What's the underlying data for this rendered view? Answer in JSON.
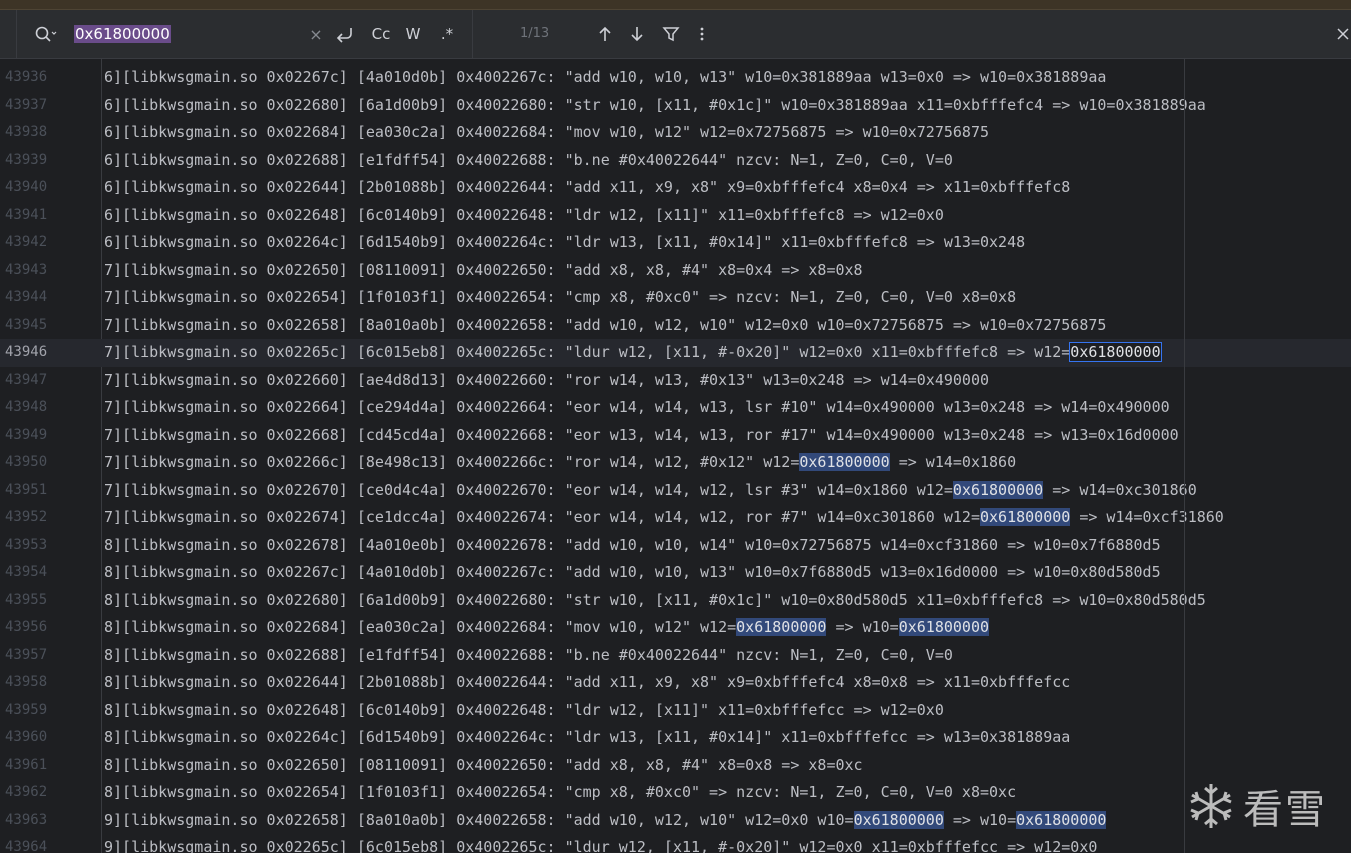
{
  "search": {
    "query": "0x61800000",
    "counter": "1/13",
    "icons": [
      "search-icon",
      "clear-icon",
      "newline-icon",
      "match-case-icon",
      "whole-word-icon",
      "regex-icon",
      "prev-match-icon",
      "next-match-icon",
      "filter-icon",
      "more-icon",
      "close-icon"
    ],
    "labels": {
      "match_case": "Cc",
      "whole_word": "W",
      "regex": ".*"
    }
  },
  "editor": {
    "current_line": "43946",
    "lines": [
      {
        "n": "43936",
        "segs": [
          {
            "t": "6][libkwsgmain.so 0x02267c] [4a010d0b] 0x4002267c: \"add w10, w10, w13\" w10=0x381889aa w13=0x0 => w10=0x381889aa"
          }
        ]
      },
      {
        "n": "43937",
        "segs": [
          {
            "t": "6][libkwsgmain.so 0x022680] [6a1d00b9] 0x40022680: \"str w10, [x11, #0x1c]\" w10=0x381889aa x11=0xbfffefc4 => w10=0x381889aa"
          }
        ]
      },
      {
        "n": "43938",
        "segs": [
          {
            "t": "6][libkwsgmain.so 0x022684] [ea030c2a] 0x40022684: \"mov w10, w12\" w12=0x72756875 => w10=0x72756875"
          }
        ]
      },
      {
        "n": "43939",
        "segs": [
          {
            "t": "6][libkwsgmain.so 0x022688] [e1fdff54] 0x40022688: \"b.ne #0x40022644\" nzcv: N=1, Z=0, C=0, V=0"
          }
        ]
      },
      {
        "n": "43940",
        "segs": [
          {
            "t": "6][libkwsgmain.so 0x022644] [2b01088b] 0x40022644: \"add x11, x9, x8\" x9=0xbfffefc4 x8=0x4 => x11=0xbfffefc8"
          }
        ]
      },
      {
        "n": "43941",
        "segs": [
          {
            "t": "6][libkwsgmain.so 0x022648] [6c0140b9] 0x40022648: \"ldr w12, [x11]\" x11=0xbfffefc8 => w12=0x0"
          }
        ]
      },
      {
        "n": "43942",
        "segs": [
          {
            "t": "6][libkwsgmain.so 0x02264c] [6d1540b9] 0x4002264c: \"ldr w13, [x11, #0x14]\" x11=0xbfffefc8 => w13=0x248"
          }
        ]
      },
      {
        "n": "43943",
        "segs": [
          {
            "t": "7][libkwsgmain.so 0x022650] [08110091] 0x40022650: \"add x8, x8, #4\" x8=0x4 => x8=0x8"
          }
        ]
      },
      {
        "n": "43944",
        "segs": [
          {
            "t": "7][libkwsgmain.so 0x022654] [1f0103f1] 0x40022654: \"cmp x8, #0xc0\" => nzcv: N=1, Z=0, C=0, V=0 x8=0x8"
          }
        ]
      },
      {
        "n": "43945",
        "segs": [
          {
            "t": "7][libkwsgmain.so 0x022658] [8a010a0b] 0x40022658: \"add w10, w12, w10\" w12=0x0 w10=0x72756875 => w10=0x72756875"
          }
        ]
      },
      {
        "n": "43946",
        "segs": [
          {
            "t": "7][libkwsgmain.so 0x02265c] [6c015eb8] 0x4002265c: \"ldur w12, [x11, #-0x20]\" w12=0x0 x11=0xbfffefc8 => w12="
          },
          {
            "t": "0x61800000",
            "c": "hl-cur"
          }
        ]
      },
      {
        "n": "43947",
        "segs": [
          {
            "t": "7][libkwsgmain.so 0x022660] [ae4d8d13] 0x40022660: \"ror w14, w13, #0x13\" w13=0x248 => w14=0x490000"
          }
        ]
      },
      {
        "n": "43948",
        "segs": [
          {
            "t": "7][libkwsgmain.so 0x022664] [ce294d4a] 0x40022664: \"eor w14, w14, w13, lsr #10\" w14=0x490000 w13=0x248 => w14=0x490000"
          }
        ]
      },
      {
        "n": "43949",
        "segs": [
          {
            "t": "7][libkwsgmain.so 0x022668] [cd45cd4a] 0x40022668: \"eor w13, w14, w13, ror #17\" w14=0x490000 w13=0x248 => w13=0x16d0000"
          }
        ]
      },
      {
        "n": "43950",
        "segs": [
          {
            "t": "7][libkwsgmain.so 0x02266c] [8e498c13] 0x4002266c: \"ror w14, w12, #0x12\" w12="
          },
          {
            "t": "0x61800000",
            "c": "hl"
          },
          {
            "t": " => w14=0x1860"
          }
        ]
      },
      {
        "n": "43951",
        "segs": [
          {
            "t": "7][libkwsgmain.so 0x022670] [ce0d4c4a] 0x40022670: \"eor w14, w14, w12, lsr #3\" w14=0x1860 w12="
          },
          {
            "t": "0x61800000",
            "c": "hl"
          },
          {
            "t": " => w14=0xc301860"
          }
        ]
      },
      {
        "n": "43952",
        "segs": [
          {
            "t": "7][libkwsgmain.so 0x022674] [ce1dcc4a] 0x40022674: \"eor w14, w14, w12, ror #7\" w14=0xc301860 w12="
          },
          {
            "t": "0x61800000",
            "c": "hl"
          },
          {
            "t": " => w14=0xcf31860"
          }
        ]
      },
      {
        "n": "43953",
        "segs": [
          {
            "t": "8][libkwsgmain.so 0x022678] [4a010e0b] 0x40022678: \"add w10, w10, w14\" w10=0x72756875 w14=0xcf31860 => w10=0x7f6880d5"
          }
        ]
      },
      {
        "n": "43954",
        "segs": [
          {
            "t": "8][libkwsgmain.so 0x02267c] [4a010d0b] 0x4002267c: \"add w10, w10, w13\" w10=0x7f6880d5 w13=0x16d0000 => w10=0x80d580d5"
          }
        ]
      },
      {
        "n": "43955",
        "segs": [
          {
            "t": "8][libkwsgmain.so 0x022680] [6a1d00b9] 0x40022680: \"str w10, [x11, #0x1c]\" w10=0x80d580d5 x11=0xbfffefc8 => w10=0x80d580d5"
          }
        ]
      },
      {
        "n": "43956",
        "segs": [
          {
            "t": "8][libkwsgmain.so 0x022684] [ea030c2a] 0x40022684: \"mov w10, w12\" w12="
          },
          {
            "t": "0x61800000",
            "c": "hl"
          },
          {
            "t": " => w10="
          },
          {
            "t": "0x61800000",
            "c": "hl"
          }
        ]
      },
      {
        "n": "43957",
        "segs": [
          {
            "t": "8][libkwsgmain.so 0x022688] [e1fdff54] 0x40022688: \"b.ne #0x40022644\" nzcv: N=1, Z=0, C=0, V=0"
          }
        ]
      },
      {
        "n": "43958",
        "segs": [
          {
            "t": "8][libkwsgmain.so 0x022644] [2b01088b] 0x40022644: \"add x11, x9, x8\" x9=0xbfffefc4 x8=0x8 => x11=0xbfffefcc"
          }
        ]
      },
      {
        "n": "43959",
        "segs": [
          {
            "t": "8][libkwsgmain.so 0x022648] [6c0140b9] 0x40022648: \"ldr w12, [x11]\" x11=0xbfffefcc => w12=0x0"
          }
        ]
      },
      {
        "n": "43960",
        "segs": [
          {
            "t": "8][libkwsgmain.so 0x02264c] [6d1540b9] 0x4002264c: \"ldr w13, [x11, #0x14]\" x11=0xbfffefcc => w13=0x381889aa"
          }
        ]
      },
      {
        "n": "43961",
        "segs": [
          {
            "t": "8][libkwsgmain.so 0x022650] [08110091] 0x40022650: \"add x8, x8, #4\" x8=0x8 => x8=0xc"
          }
        ]
      },
      {
        "n": "43962",
        "segs": [
          {
            "t": "8][libkwsgmain.so 0x022654] [1f0103f1] 0x40022654: \"cmp x8, #0xc0\" => nzcv: N=1, Z=0, C=0, V=0 x8=0xc"
          }
        ]
      },
      {
        "n": "43963",
        "segs": [
          {
            "t": "9][libkwsgmain.so 0x022658] [8a010a0b] 0x40022658: \"add w10, w12, w10\" w12=0x0 w10="
          },
          {
            "t": "0x61800000",
            "c": "hl"
          },
          {
            "t": " => w10="
          },
          {
            "t": "0x61800000",
            "c": "hl"
          }
        ]
      },
      {
        "n": "43964",
        "segs": [
          {
            "t": "9][libkwsgmain.so 0x02265c] [6c015eb8] 0x4002265c: \"ldur w12, [x11, #-0x20]\" w12=0x0 x11=0xbfffefcc => w12=0x0"
          }
        ]
      }
    ]
  },
  "watermark": {
    "text": "看雪",
    "icon": "snowflake-icon"
  },
  "colors": {
    "background": "#1e1f22",
    "toolbar": "#2b2d30",
    "match_highlight": "#32497a",
    "selection": "#6a4c8a",
    "accent": "#3574f0"
  }
}
